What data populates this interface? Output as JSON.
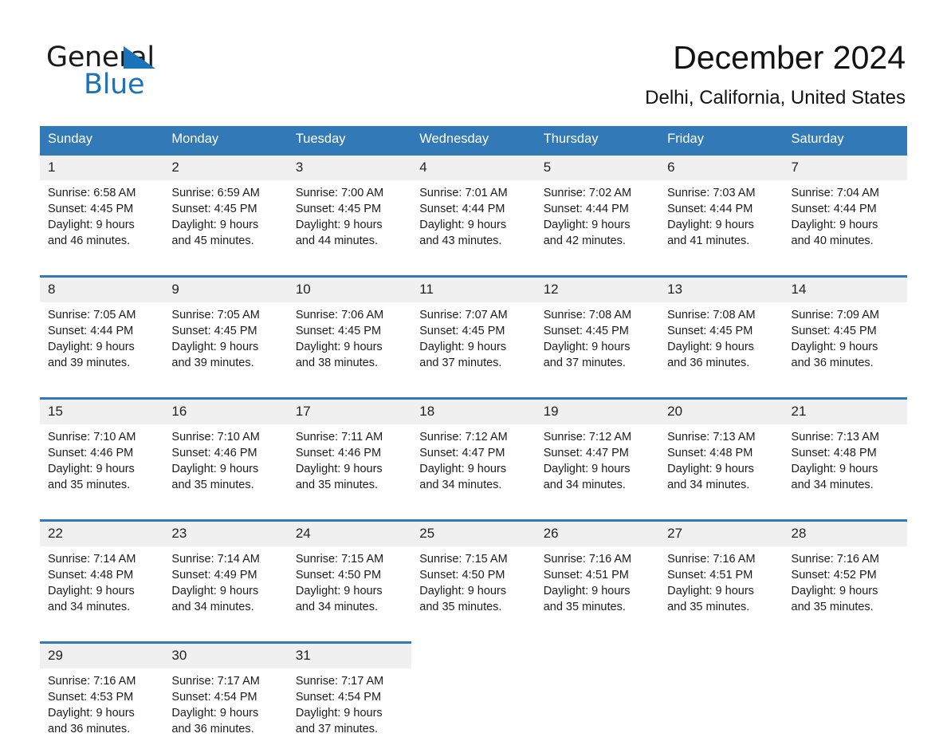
{
  "brand": {
    "name_top": "General",
    "name_bottom": "Blue",
    "accent_color": "#1b74ba"
  },
  "header": {
    "title": "December 2024",
    "subtitle": "Delhi, California, United States"
  },
  "theme": {
    "header_row_color": "#3179b7",
    "date_cell_color": "#f0f0f0",
    "page_background": "#ffffff",
    "text_color": "#1b1b1b"
  },
  "weekday_headers": [
    "Sunday",
    "Monday",
    "Tuesday",
    "Wednesday",
    "Thursday",
    "Friday",
    "Saturday"
  ],
  "weeks": [
    [
      {
        "day": "1",
        "sunrise": "Sunrise: 6:58 AM",
        "sunset": "Sunset: 4:45 PM",
        "daylight_line1": "Daylight: 9 hours",
        "daylight_line2": "and 46 minutes."
      },
      {
        "day": "2",
        "sunrise": "Sunrise: 6:59 AM",
        "sunset": "Sunset: 4:45 PM",
        "daylight_line1": "Daylight: 9 hours",
        "daylight_line2": "and 45 minutes."
      },
      {
        "day": "3",
        "sunrise": "Sunrise: 7:00 AM",
        "sunset": "Sunset: 4:45 PM",
        "daylight_line1": "Daylight: 9 hours",
        "daylight_line2": "and 44 minutes."
      },
      {
        "day": "4",
        "sunrise": "Sunrise: 7:01 AM",
        "sunset": "Sunset: 4:44 PM",
        "daylight_line1": "Daylight: 9 hours",
        "daylight_line2": "and 43 minutes."
      },
      {
        "day": "5",
        "sunrise": "Sunrise: 7:02 AM",
        "sunset": "Sunset: 4:44 PM",
        "daylight_line1": "Daylight: 9 hours",
        "daylight_line2": "and 42 minutes."
      },
      {
        "day": "6",
        "sunrise": "Sunrise: 7:03 AM",
        "sunset": "Sunset: 4:44 PM",
        "daylight_line1": "Daylight: 9 hours",
        "daylight_line2": "and 41 minutes."
      },
      {
        "day": "7",
        "sunrise": "Sunrise: 7:04 AM",
        "sunset": "Sunset: 4:44 PM",
        "daylight_line1": "Daylight: 9 hours",
        "daylight_line2": "and 40 minutes."
      }
    ],
    [
      {
        "day": "8",
        "sunrise": "Sunrise: 7:05 AM",
        "sunset": "Sunset: 4:44 PM",
        "daylight_line1": "Daylight: 9 hours",
        "daylight_line2": "and 39 minutes."
      },
      {
        "day": "9",
        "sunrise": "Sunrise: 7:05 AM",
        "sunset": "Sunset: 4:45 PM",
        "daylight_line1": "Daylight: 9 hours",
        "daylight_line2": "and 39 minutes."
      },
      {
        "day": "10",
        "sunrise": "Sunrise: 7:06 AM",
        "sunset": "Sunset: 4:45 PM",
        "daylight_line1": "Daylight: 9 hours",
        "daylight_line2": "and 38 minutes."
      },
      {
        "day": "11",
        "sunrise": "Sunrise: 7:07 AM",
        "sunset": "Sunset: 4:45 PM",
        "daylight_line1": "Daylight: 9 hours",
        "daylight_line2": "and 37 minutes."
      },
      {
        "day": "12",
        "sunrise": "Sunrise: 7:08 AM",
        "sunset": "Sunset: 4:45 PM",
        "daylight_line1": "Daylight: 9 hours",
        "daylight_line2": "and 37 minutes."
      },
      {
        "day": "13",
        "sunrise": "Sunrise: 7:08 AM",
        "sunset": "Sunset: 4:45 PM",
        "daylight_line1": "Daylight: 9 hours",
        "daylight_line2": "and 36 minutes."
      },
      {
        "day": "14",
        "sunrise": "Sunrise: 7:09 AM",
        "sunset": "Sunset: 4:45 PM",
        "daylight_line1": "Daylight: 9 hours",
        "daylight_line2": "and 36 minutes."
      }
    ],
    [
      {
        "day": "15",
        "sunrise": "Sunrise: 7:10 AM",
        "sunset": "Sunset: 4:46 PM",
        "daylight_line1": "Daylight: 9 hours",
        "daylight_line2": "and 35 minutes."
      },
      {
        "day": "16",
        "sunrise": "Sunrise: 7:10 AM",
        "sunset": "Sunset: 4:46 PM",
        "daylight_line1": "Daylight: 9 hours",
        "daylight_line2": "and 35 minutes."
      },
      {
        "day": "17",
        "sunrise": "Sunrise: 7:11 AM",
        "sunset": "Sunset: 4:46 PM",
        "daylight_line1": "Daylight: 9 hours",
        "daylight_line2": "and 35 minutes."
      },
      {
        "day": "18",
        "sunrise": "Sunrise: 7:12 AM",
        "sunset": "Sunset: 4:47 PM",
        "daylight_line1": "Daylight: 9 hours",
        "daylight_line2": "and 34 minutes."
      },
      {
        "day": "19",
        "sunrise": "Sunrise: 7:12 AM",
        "sunset": "Sunset: 4:47 PM",
        "daylight_line1": "Daylight: 9 hours",
        "daylight_line2": "and 34 minutes."
      },
      {
        "day": "20",
        "sunrise": "Sunrise: 7:13 AM",
        "sunset": "Sunset: 4:48 PM",
        "daylight_line1": "Daylight: 9 hours",
        "daylight_line2": "and 34 minutes."
      },
      {
        "day": "21",
        "sunrise": "Sunrise: 7:13 AM",
        "sunset": "Sunset: 4:48 PM",
        "daylight_line1": "Daylight: 9 hours",
        "daylight_line2": "and 34 minutes."
      }
    ],
    [
      {
        "day": "22",
        "sunrise": "Sunrise: 7:14 AM",
        "sunset": "Sunset: 4:48 PM",
        "daylight_line1": "Daylight: 9 hours",
        "daylight_line2": "and 34 minutes."
      },
      {
        "day": "23",
        "sunrise": "Sunrise: 7:14 AM",
        "sunset": "Sunset: 4:49 PM",
        "daylight_line1": "Daylight: 9 hours",
        "daylight_line2": "and 34 minutes."
      },
      {
        "day": "24",
        "sunrise": "Sunrise: 7:15 AM",
        "sunset": "Sunset: 4:50 PM",
        "daylight_line1": "Daylight: 9 hours",
        "daylight_line2": "and 34 minutes."
      },
      {
        "day": "25",
        "sunrise": "Sunrise: 7:15 AM",
        "sunset": "Sunset: 4:50 PM",
        "daylight_line1": "Daylight: 9 hours",
        "daylight_line2": "and 35 minutes."
      },
      {
        "day": "26",
        "sunrise": "Sunrise: 7:16 AM",
        "sunset": "Sunset: 4:51 PM",
        "daylight_line1": "Daylight: 9 hours",
        "daylight_line2": "and 35 minutes."
      },
      {
        "day": "27",
        "sunrise": "Sunrise: 7:16 AM",
        "sunset": "Sunset: 4:51 PM",
        "daylight_line1": "Daylight: 9 hours",
        "daylight_line2": "and 35 minutes."
      },
      {
        "day": "28",
        "sunrise": "Sunrise: 7:16 AM",
        "sunset": "Sunset: 4:52 PM",
        "daylight_line1": "Daylight: 9 hours",
        "daylight_line2": "and 35 minutes."
      }
    ],
    [
      {
        "day": "29",
        "sunrise": "Sunrise: 7:16 AM",
        "sunset": "Sunset: 4:53 PM",
        "daylight_line1": "Daylight: 9 hours",
        "daylight_line2": "and 36 minutes."
      },
      {
        "day": "30",
        "sunrise": "Sunrise: 7:17 AM",
        "sunset": "Sunset: 4:54 PM",
        "daylight_line1": "Daylight: 9 hours",
        "daylight_line2": "and 36 minutes."
      },
      {
        "day": "31",
        "sunrise": "Sunrise: 7:17 AM",
        "sunset": "Sunset: 4:54 PM",
        "daylight_line1": "Daylight: 9 hours",
        "daylight_line2": "and 37 minutes."
      },
      {
        "day": "",
        "sunrise": "",
        "sunset": "",
        "daylight_line1": "",
        "daylight_line2": ""
      },
      {
        "day": "",
        "sunrise": "",
        "sunset": "",
        "daylight_line1": "",
        "daylight_line2": ""
      },
      {
        "day": "",
        "sunrise": "",
        "sunset": "",
        "daylight_line1": "",
        "daylight_line2": ""
      },
      {
        "day": "",
        "sunrise": "",
        "sunset": "",
        "daylight_line1": "",
        "daylight_line2": ""
      }
    ]
  ]
}
